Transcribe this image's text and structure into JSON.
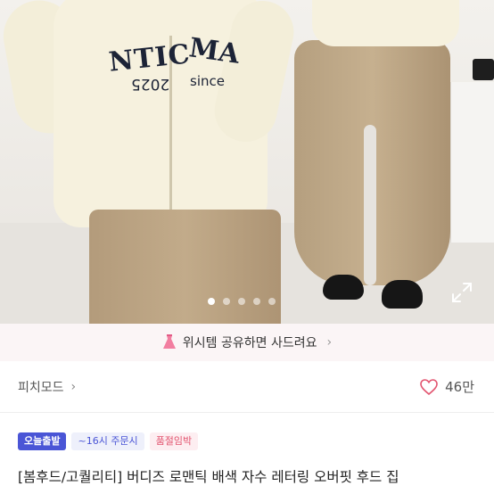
{
  "hero": {
    "print_left": "MA NTIC",
    "print_left_a": "NTIC",
    "print_left_b": "MA",
    "print_sub_a": "2025",
    "print_sub_b": "since",
    "carousel": {
      "count": 5,
      "active_index": 0
    }
  },
  "banner": {
    "text": "위시템 공유하면 사드려요",
    "chevron": "›"
  },
  "shop": {
    "name": "피치모드",
    "chevron": "›",
    "likes": "46만"
  },
  "badges": {
    "b1": "오늘출발",
    "b2": "~16시 주문시",
    "b3": "품절임박"
  },
  "product": {
    "title": "[봄후드/고퀄리티] 버디즈 로맨틱 배색 자수 레터링 오버핏 후드 집"
  },
  "colors": {
    "accent": "#4a55d6",
    "heart": "#e2546f",
    "banner_bg": "#fbf5f6"
  },
  "icons": {
    "banner": "dress-icon",
    "expand": "expand-icon",
    "likes": "heart-icon",
    "chevron": "chevron-right-icon"
  }
}
